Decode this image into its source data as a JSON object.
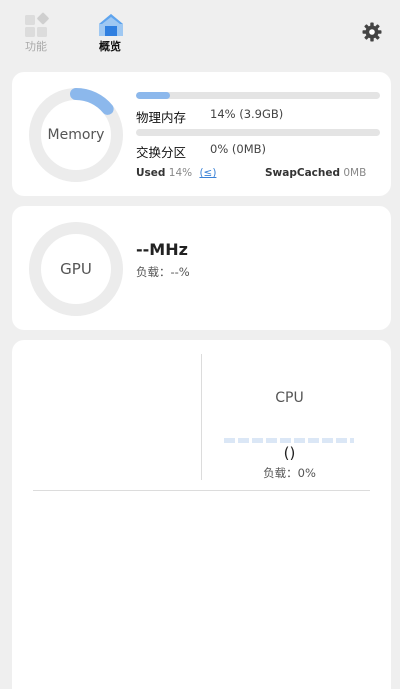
{
  "nav": {
    "features_label": "功能",
    "overview_label": "概览",
    "active": "overview",
    "settings_icon": "gear-icon"
  },
  "memory": {
    "ring_label": "Memory",
    "ring_used_fraction": 0.14,
    "physical": {
      "label": "物理内存",
      "value": "14% (3.9GB)",
      "fill_fraction": 0.14
    },
    "swap": {
      "label": "交换分区",
      "value": "0% (0MB)",
      "fill_fraction": 0.0
    },
    "used_label": "Used",
    "used_value": "14%",
    "used_link": "(≤)",
    "swapcached_label": "SwapCached",
    "swapcached_value": "0MB"
  },
  "gpu": {
    "ring_label": "GPU",
    "frequency": "--MHz",
    "load": "负载：--%"
  },
  "cpu": {
    "title": "CPU",
    "value": "()",
    "load": "负载：0%"
  },
  "colors": {
    "accent": "#8cb8ec",
    "ring_track": "#ececec",
    "background": "#efefef",
    "link": "#3b82d6"
  }
}
